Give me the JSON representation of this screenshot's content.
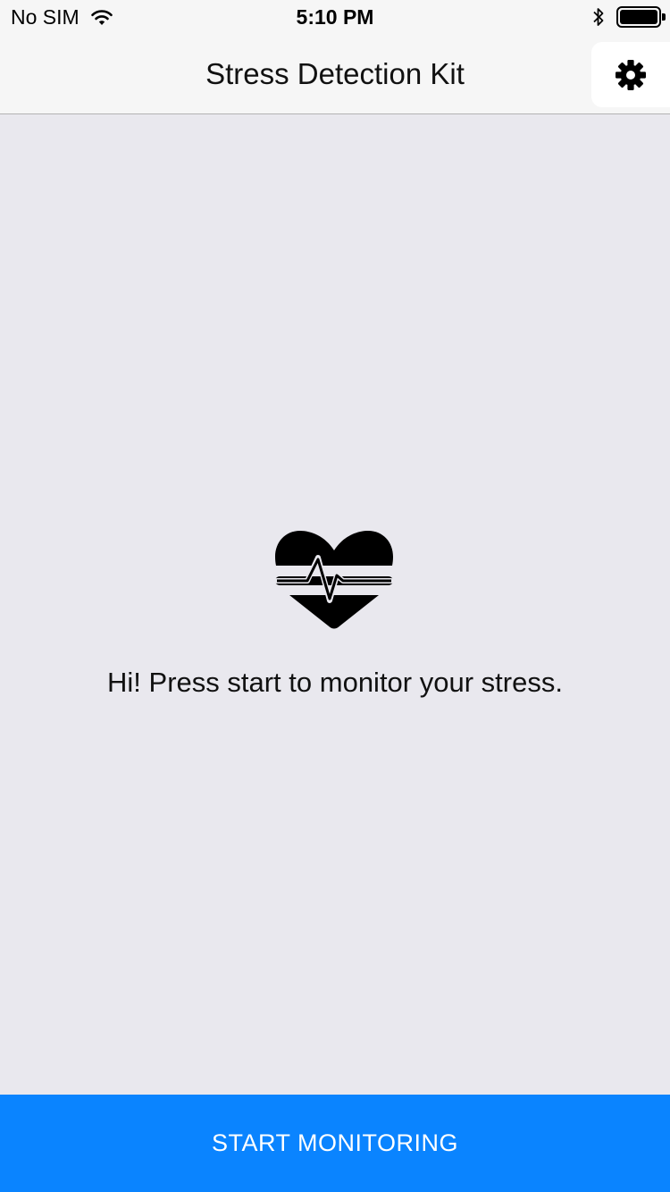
{
  "status_bar": {
    "carrier": "No SIM",
    "time": "5:10 PM",
    "icons": [
      "wifi-icon",
      "bluetooth-icon",
      "battery-icon"
    ]
  },
  "nav": {
    "title": "Stress Detection Kit",
    "settings_icon": "gear-icon"
  },
  "main": {
    "icon": "heart-pulse-icon",
    "message": "Hi! Press start to monitor your stress."
  },
  "footer": {
    "start_label": "START MONITORING"
  },
  "colors": {
    "accent": "#0a84ff",
    "background": "#e9e8ee",
    "bar": "#f6f6f6"
  }
}
